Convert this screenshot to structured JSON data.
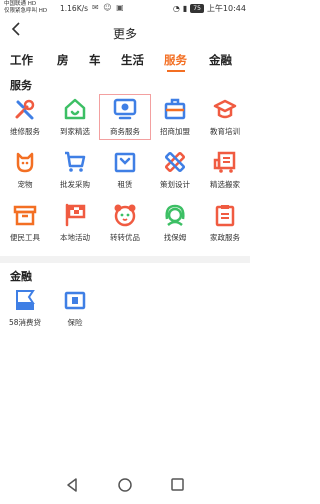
{
  "status_bar": {
    "carrier_line1": "中国联通 HD",
    "carrier_line2": "仅限紧急呼叫 HD",
    "net_speed": "1.16K/s",
    "battery": "75",
    "time": "上午10:44"
  },
  "header": {
    "back_icon": "chevron-left-icon",
    "title": "更多"
  },
  "tabs": [
    {
      "label": "工作"
    },
    {
      "label": "房"
    },
    {
      "label": "车"
    },
    {
      "label": "生活"
    },
    {
      "label": "服务",
      "active": true
    },
    {
      "label": "金融"
    }
  ],
  "sections": {
    "service": {
      "title": "服务",
      "items": [
        {
          "label": "维修服务",
          "icon": "repair-tools-icon"
        },
        {
          "label": "到家精选",
          "icon": "home-check-icon"
        },
        {
          "label": "商务服务",
          "icon": "business-monitor-icon",
          "selected": true
        },
        {
          "label": "招商加盟",
          "icon": "briefcase-icon"
        },
        {
          "label": "教育培训",
          "icon": "graduation-cap-icon"
        },
        {
          "label": "宠物",
          "icon": "pet-dog-icon"
        },
        {
          "label": "批发采购",
          "icon": "shopping-cart-icon"
        },
        {
          "label": "租赁",
          "icon": "rental-bag-icon"
        },
        {
          "label": "策划设计",
          "icon": "design-ruler-icon"
        },
        {
          "label": "精选搬家",
          "icon": "moving-truck-icon"
        },
        {
          "label": "便民工具",
          "icon": "toolbox-icon"
        },
        {
          "label": "本地活动",
          "icon": "event-flag-icon"
        },
        {
          "label": "转转优品",
          "icon": "panda-icon"
        },
        {
          "label": "找保姆",
          "icon": "nanny-icon"
        },
        {
          "label": "家政服务",
          "icon": "housekeeping-clipboard-icon"
        }
      ]
    },
    "finance": {
      "title": "金融",
      "items": [
        {
          "label": "58消费贷",
          "icon": "consumer-loan-icon"
        },
        {
          "label": "保险",
          "icon": "insurance-icon"
        }
      ]
    }
  },
  "nav_bar": {
    "back": "nav-back-icon",
    "home": "nav-home-icon",
    "recents": "nav-recents-icon"
  },
  "colors": {
    "accent": "#f36f23",
    "blue": "#3f7fe5",
    "green": "#3cbf64",
    "red": "#f05b41"
  }
}
